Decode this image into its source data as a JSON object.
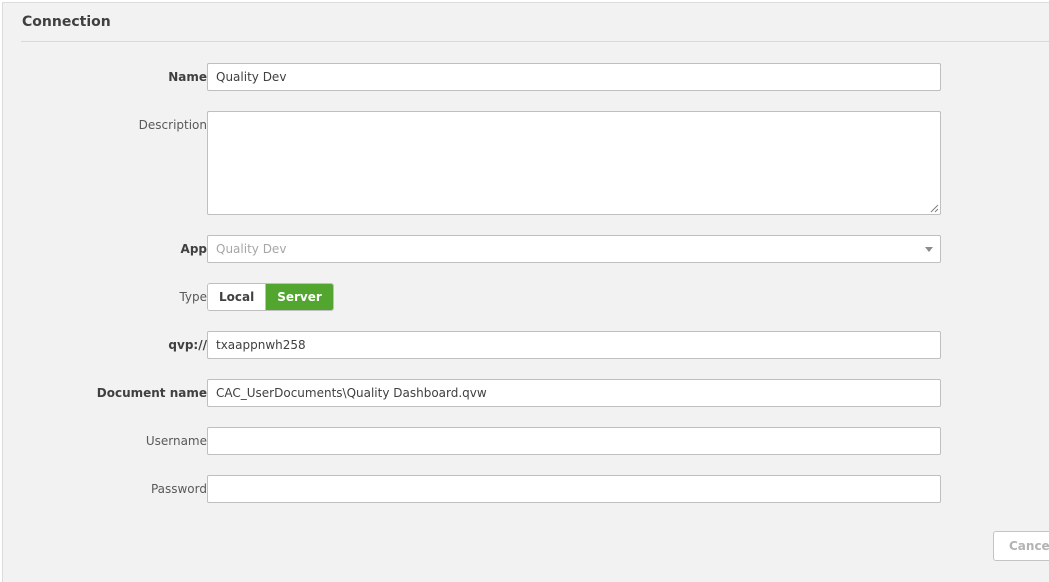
{
  "section": {
    "title": "Connection"
  },
  "form": {
    "name": {
      "label": "Name",
      "value": "Quality Dev"
    },
    "description": {
      "label": "Description",
      "value": ""
    },
    "app": {
      "label": "App",
      "selected": "Quality Dev"
    },
    "type": {
      "label": "Type",
      "options": [
        "Local",
        "Server"
      ],
      "selected": "Server"
    },
    "qvp": {
      "label": "qvp://",
      "value": "txaappnwh258"
    },
    "document_name": {
      "label": "Document name",
      "value": "CAC_UserDocuments\\Quality Dashboard.qvw"
    },
    "username": {
      "label": "Username",
      "value": ""
    },
    "password": {
      "label": "Password",
      "value": ""
    }
  },
  "actions": {
    "cancel_label": "Cancel"
  },
  "colors": {
    "accent": "#52a52e",
    "panel_bg": "#f2f2f2",
    "border": "#bfbfbf"
  }
}
